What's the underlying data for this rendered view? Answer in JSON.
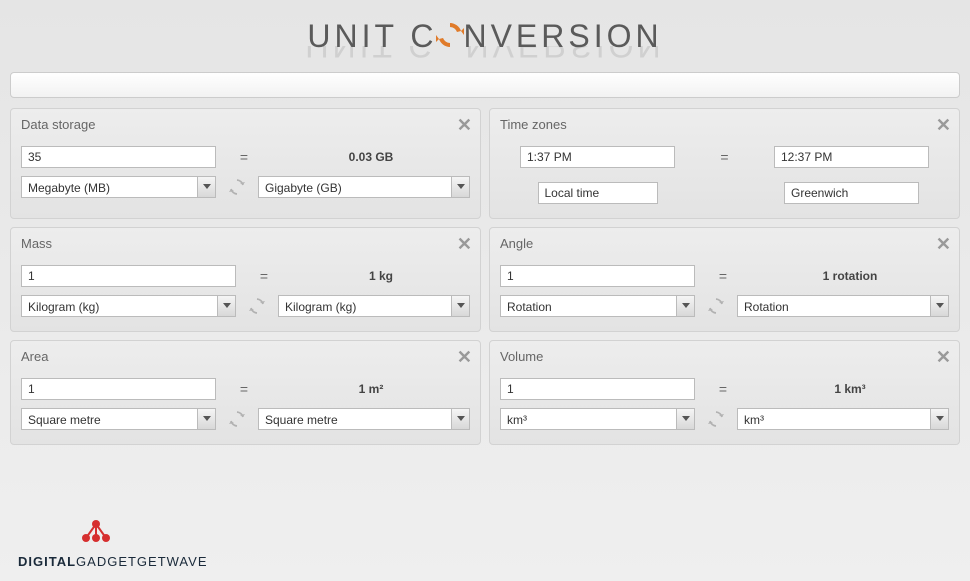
{
  "header": {
    "title_left": "UNIT C",
    "title_right": "NVERSION"
  },
  "panels": {
    "data_storage": {
      "title": "Data storage",
      "input_value": "35",
      "result": "0.03 GB",
      "from_unit": "Megabyte (MB)",
      "to_unit": "Gigabyte (GB)"
    },
    "time_zones": {
      "title": "Time zones",
      "left_time": "1:37 PM",
      "right_time": "12:37 PM",
      "left_zone": "Local time",
      "right_zone": "Greenwich"
    },
    "mass": {
      "title": "Mass",
      "input_value": "1",
      "result": "1 kg",
      "from_unit": "Kilogram (kg)",
      "to_unit": "Kilogram (kg)"
    },
    "angle": {
      "title": "Angle",
      "input_value": "1",
      "result": "1 rotation",
      "from_unit": "Rotation",
      "to_unit": "Rotation"
    },
    "area": {
      "title": "Area",
      "input_value": "1",
      "result": "1 m²",
      "from_unit": "Square metre",
      "to_unit": "Square metre"
    },
    "volume": {
      "title": "Volume",
      "input_value": "1",
      "result": "1 km³",
      "from_unit": "km³",
      "to_unit": "km³"
    }
  },
  "watermark": {
    "bold": "DIGITAL",
    "rest": "GADGETGETWAVE"
  }
}
